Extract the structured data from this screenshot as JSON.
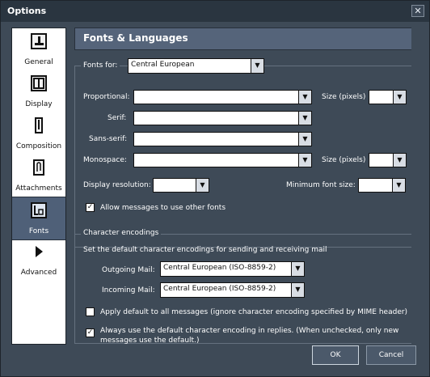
{
  "window": {
    "title": "Options",
    "close_glyph": "✕"
  },
  "sidebar": {
    "items": [
      {
        "label": "General",
        "icon": "stamp-icon"
      },
      {
        "label": "Display",
        "icon": "window-icon"
      },
      {
        "label": "Composition",
        "icon": "pen-icon"
      },
      {
        "label": "Attachments",
        "icon": "paperclip-icon"
      },
      {
        "label": "Fonts",
        "icon": "font-icon"
      },
      {
        "label": "Advanced",
        "icon": "arrow-icon"
      }
    ],
    "selected": "Fonts"
  },
  "header": {
    "title": "Fonts & Languages"
  },
  "fonts_group": {
    "fonts_for_label": "Fonts for:",
    "fonts_for_value": "Central European",
    "proportional_label": "Proportional:",
    "serif_label": "Serif:",
    "sans_serif_label": "Sans-serif:",
    "monospace_label": "Monospace:",
    "size_label_1": "Size (pixels)",
    "size_label_2": "Size (pixels)",
    "display_resolution_label": "Display resolution:",
    "min_font_size_label": "Minimum font size:",
    "allow_label": "Allow messages to use other fonts",
    "allow_checked": true
  },
  "encodings_group": {
    "legend": "Character encodings",
    "description": "Set the default character encodings for sending and receiving mail",
    "outgoing_label": "Outgoing Mail:",
    "outgoing_value": "Central European (ISO-8859-2)",
    "incoming_label": "Incoming Mail:",
    "incoming_value": "Central European (ISO-8859-2)",
    "apply_default_label": "Apply default to all messages (ignore character encoding specified by MIME header)",
    "apply_default_checked": false,
    "always_use_label": "Always use the default character encoding in replies. (When unchecked, only new messages use the default.)",
    "always_use_checked": true
  },
  "buttons": {
    "ok": "OK",
    "cancel": "Cancel"
  },
  "glyphs": {
    "dropdown": "▼",
    "check": "✓"
  }
}
